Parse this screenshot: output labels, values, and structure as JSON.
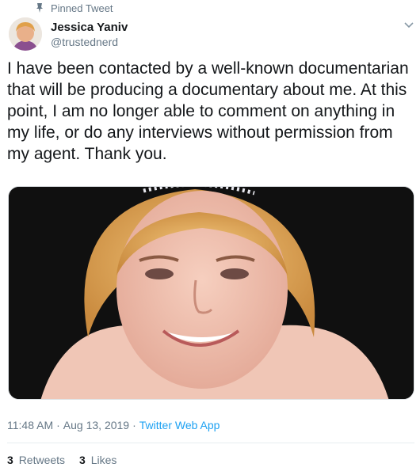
{
  "pinned": {
    "label": "Pinned Tweet",
    "icon": "pin-icon"
  },
  "author": {
    "name": "Jessica Yaniv",
    "handle": "@trustednerd",
    "avatar_icon": "avatar"
  },
  "menu": {
    "icon": "chevron-down-icon"
  },
  "tweet": {
    "text": "I have been contacted by a well-known documentarian that will be producing a documentary about me. At this point, I am no longer able to comment on anything in my life, or do any interviews without permission from my agent. Thank you."
  },
  "meta": {
    "time": "11:48 AM",
    "sep1": "·",
    "date": "Aug 13, 2019",
    "sep2": "·",
    "source": "Twitter Web App"
  },
  "stats": {
    "retweets_count": "3",
    "retweets_label": "Retweets",
    "likes_count": "3",
    "likes_label": "Likes"
  },
  "colors": {
    "link": "#1da1f2",
    "secondary_text": "#657786",
    "primary_text": "#14171a",
    "divider": "#e6ecf0"
  }
}
